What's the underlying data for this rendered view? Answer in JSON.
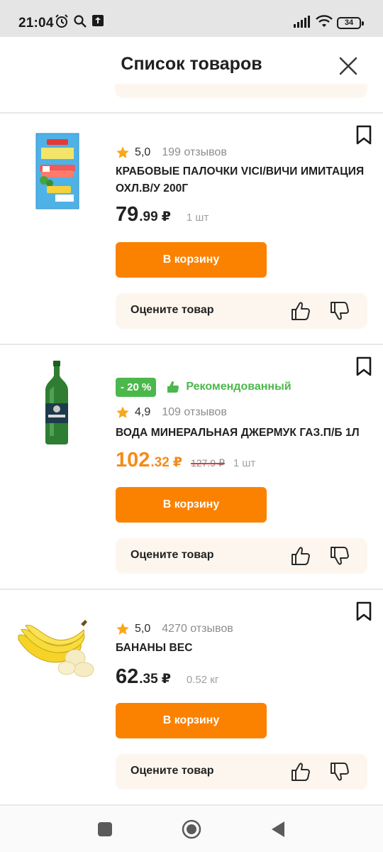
{
  "status_bar": {
    "time": "21:04",
    "battery": "34",
    "icons": [
      "alarm-icon",
      "search-icon",
      "upload-notification-icon",
      "signal-icon",
      "wifi-icon",
      "battery-icon"
    ]
  },
  "header": {
    "title": "Список товаров",
    "close_icon": "close-icon"
  },
  "products": [
    {
      "rating": "5,0",
      "reviews": "199 отзывов",
      "name": "КРАБОВЫЕ ПАЛОЧКИ VICI/ВИЧИ ИМИТАЦИЯ ОХЛ.В/У 200Г",
      "price_int": "79",
      "price_frac": ".99",
      "currency": "₽",
      "qty": "1 шт",
      "cart_label": "В корзину",
      "rate_label": "Оцените товар"
    },
    {
      "discount": "- 20 %",
      "recommended": "Рекомендованный",
      "rating": "4,9",
      "reviews": "109 отзывов",
      "name": "ВОДА МИНЕРАЛЬНАЯ ДЖЕРМУК ГАЗ.П/Б 1Л",
      "price_int": "102",
      "price_frac": ".32",
      "currency": "₽",
      "old_price": "127.9 ₽",
      "qty": "1 шт",
      "cart_label": "В корзину",
      "rate_label": "Оцените товар"
    },
    {
      "rating": "5,0",
      "reviews": "4270 отзывов",
      "name": "БАНАНЫ ВЕС",
      "price_int": "62",
      "price_frac": ".35",
      "currency": "₽",
      "qty": "0.52 кг",
      "cart_label": "В корзину",
      "rate_label": "Оцените товар"
    }
  ],
  "colors": {
    "accent": "#fb8201",
    "sale_price": "#f68a1a",
    "green": "#4cb84c",
    "star": "#f7a81b",
    "rate_bg": "#fdf6ee"
  },
  "navigation": {
    "icons": [
      "recent-apps-icon",
      "home-icon",
      "back-icon"
    ]
  }
}
